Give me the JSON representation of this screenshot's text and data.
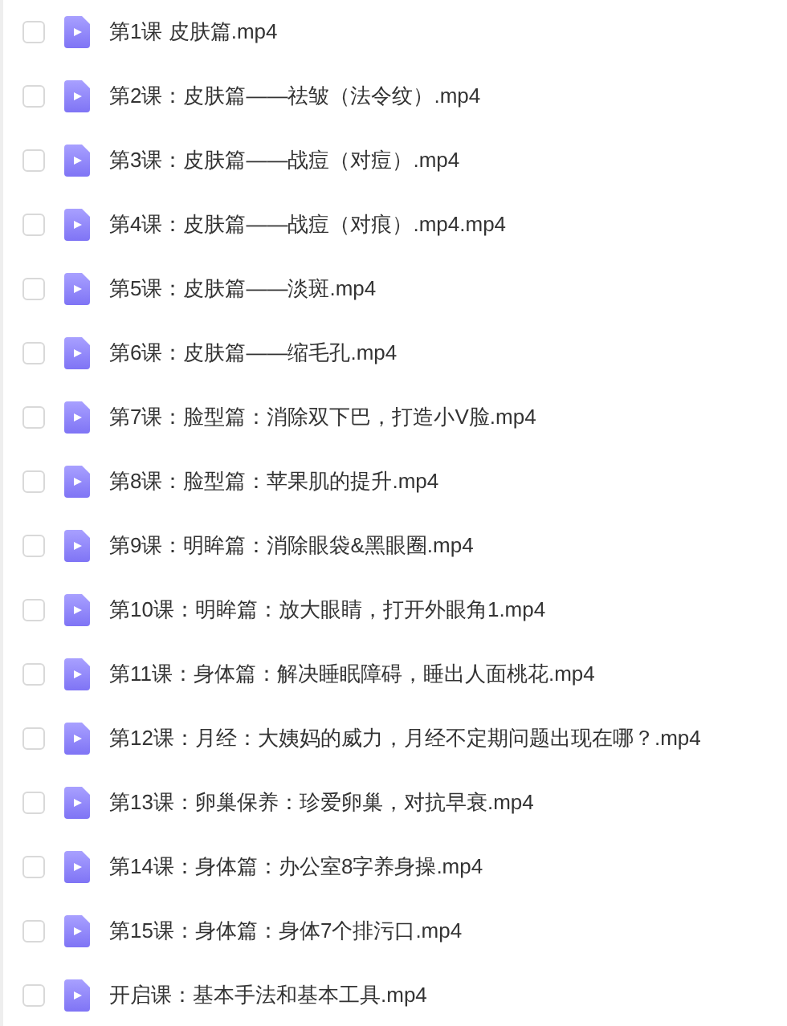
{
  "files": [
    {
      "name": "第1课 皮肤篇.mp4",
      "checked": false
    },
    {
      "name": "第2课：皮肤篇——祛皱（法令纹）.mp4",
      "checked": false
    },
    {
      "name": "第3课：皮肤篇——战痘（对痘）.mp4",
      "checked": false
    },
    {
      "name": "第4课：皮肤篇——战痘（对痕）.mp4.mp4",
      "checked": false
    },
    {
      "name": "第5课：皮肤篇——淡斑.mp4",
      "checked": false
    },
    {
      "name": "第6课：皮肤篇——缩毛孔.mp4",
      "checked": false
    },
    {
      "name": "第7课：脸型篇：消除双下巴，打造小V脸.mp4",
      "checked": false
    },
    {
      "name": "第8课：脸型篇：苹果肌的提升.mp4",
      "checked": false
    },
    {
      "name": "第9课：明眸篇：消除眼袋&黑眼圈.mp4",
      "checked": false
    },
    {
      "name": "第10课：明眸篇：放大眼睛，打开外眼角1.mp4",
      "checked": false
    },
    {
      "name": "第11课：身体篇：解决睡眠障碍，睡出人面桃花.mp4",
      "checked": false
    },
    {
      "name": "第12课：月经：大姨妈的威力，月经不定期问题出现在哪？.mp4",
      "checked": false
    },
    {
      "name": "第13课：卵巢保养：珍爱卵巢，对抗早衰.mp4",
      "checked": false
    },
    {
      "name": "第14课：身体篇：办公室8字养身操.mp4",
      "checked": false
    },
    {
      "name": "第15课：身体篇：身体7个排污口.mp4",
      "checked": false
    },
    {
      "name": "开启课：基本手法和基本工具.mp4",
      "checked": false
    }
  ]
}
